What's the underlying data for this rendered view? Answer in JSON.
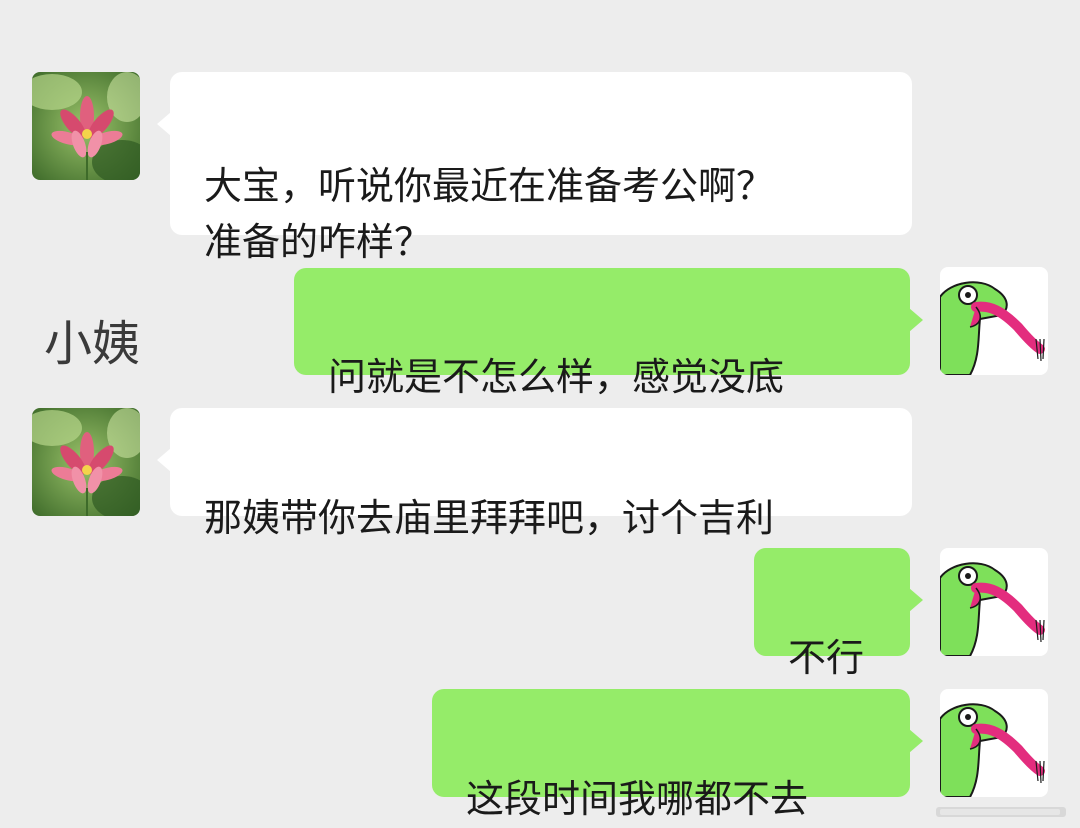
{
  "chat": {
    "contact_label": "小姨",
    "messages": [
      {
        "side": "left",
        "sender": "小姨",
        "text": "大宝，听说你最近在准备考公啊？\n准备的咋样？"
      },
      {
        "side": "right",
        "sender": "me",
        "text": "问就是不怎么样，感觉没底"
      },
      {
        "side": "left",
        "sender": "小姨",
        "text": "那姨带你去庙里拜拜吧，讨个吉利"
      },
      {
        "side": "right",
        "sender": "me",
        "text": "不行"
      },
      {
        "side": "right",
        "sender": "me",
        "text": "这段时间我哪都不去"
      }
    ]
  },
  "avatars": {
    "left": "lotus-flower-avatar",
    "right": "green-frog-avatar"
  },
  "colors": {
    "background": "#ededed",
    "left_bubble": "#ffffff",
    "right_bubble": "#95ec69",
    "text": "#1a1a1a"
  }
}
